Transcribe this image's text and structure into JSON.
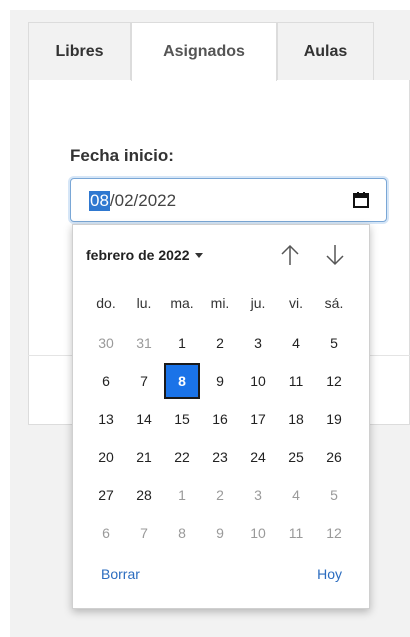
{
  "tabs": [
    {
      "label": "Libres"
    },
    {
      "label": "Asignados"
    },
    {
      "label": "Aulas"
    }
  ],
  "form": {
    "date_label": "Fecha inicio:",
    "date_value": {
      "day": "08",
      "rest": "/02/2022"
    }
  },
  "datepicker": {
    "month_label": "febrero de 2022",
    "weekdays": [
      "do.",
      "lu.",
      "ma.",
      "mi.",
      "ju.",
      "vi.",
      "sá."
    ],
    "weeks": [
      [
        {
          "d": "30",
          "o": true
        },
        {
          "d": "31",
          "o": true
        },
        {
          "d": "1"
        },
        {
          "d": "2"
        },
        {
          "d": "3"
        },
        {
          "d": "4"
        },
        {
          "d": "5"
        }
      ],
      [
        {
          "d": "6"
        },
        {
          "d": "7"
        },
        {
          "d": "8",
          "sel": true
        },
        {
          "d": "9"
        },
        {
          "d": "10"
        },
        {
          "d": "11"
        },
        {
          "d": "12"
        }
      ],
      [
        {
          "d": "13"
        },
        {
          "d": "14"
        },
        {
          "d": "15"
        },
        {
          "d": "16"
        },
        {
          "d": "17"
        },
        {
          "d": "18"
        },
        {
          "d": "19"
        }
      ],
      [
        {
          "d": "20"
        },
        {
          "d": "21"
        },
        {
          "d": "22"
        },
        {
          "d": "23"
        },
        {
          "d": "24"
        },
        {
          "d": "25"
        },
        {
          "d": "26"
        }
      ],
      [
        {
          "d": "27"
        },
        {
          "d": "28"
        },
        {
          "d": "1",
          "o": true
        },
        {
          "d": "2",
          "o": true
        },
        {
          "d": "3",
          "o": true
        },
        {
          "d": "4",
          "o": true
        },
        {
          "d": "5",
          "o": true
        }
      ],
      [
        {
          "d": "6",
          "o": true
        },
        {
          "d": "7",
          "o": true
        },
        {
          "d": "8",
          "o": true
        },
        {
          "d": "9",
          "o": true
        },
        {
          "d": "10",
          "o": true
        },
        {
          "d": "11",
          "o": true
        },
        {
          "d": "12",
          "o": true
        }
      ]
    ],
    "clear_label": "Borrar",
    "today_label": "Hoy",
    "icons": {
      "prev": "arrow-up-icon",
      "next": "arrow-down-icon",
      "calendar": "calendar-icon"
    },
    "colors": {
      "selected_bg": "#1a73e8",
      "link": "#2b6cbf",
      "input_focus": "#7aa7d6"
    }
  }
}
